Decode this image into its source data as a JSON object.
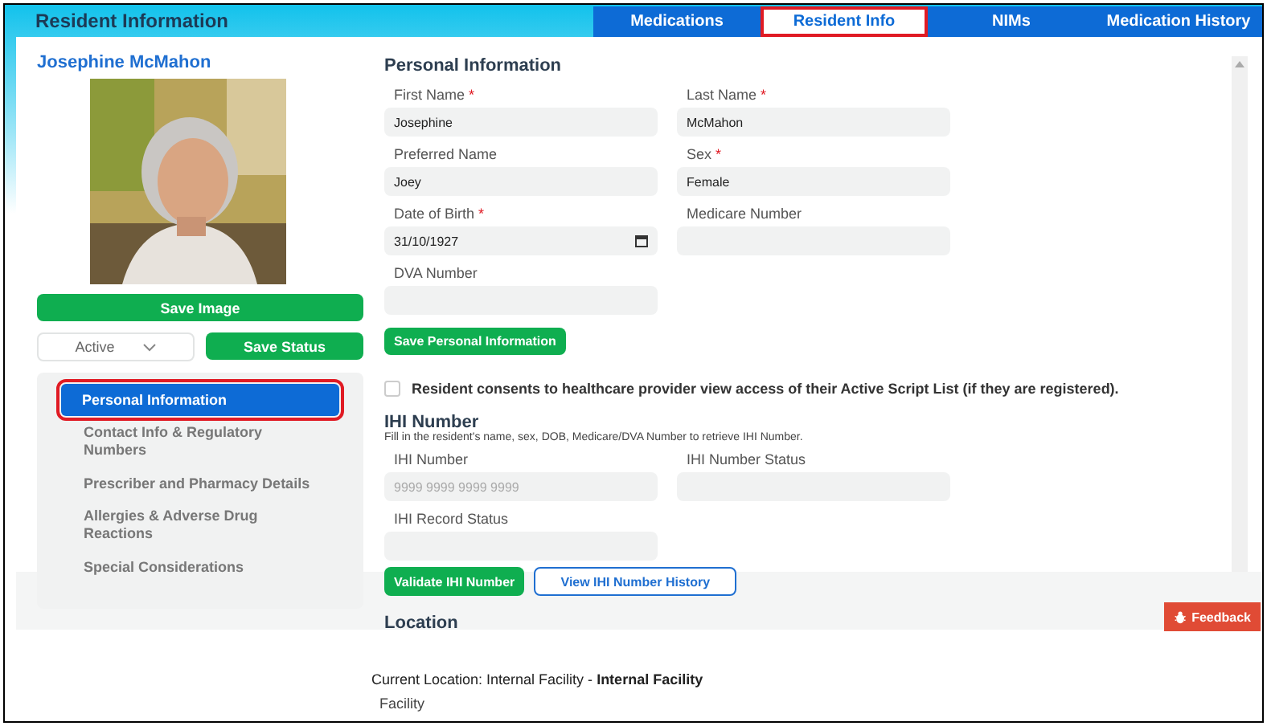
{
  "header": {
    "title": "Resident Information"
  },
  "tabs": [
    {
      "label": "Medications",
      "selected": false
    },
    {
      "label": "Resident Info",
      "selected": true
    },
    {
      "label": "NIMs",
      "selected": false
    },
    {
      "label": "Medication History",
      "selected": false
    }
  ],
  "resident": {
    "name": "Josephine McMahon",
    "save_image": "Save Image",
    "status": "Active",
    "save_status": "Save Status"
  },
  "nav": [
    {
      "label": "Personal Information",
      "selected": true
    },
    {
      "label": "Contact Info & Regulatory Numbers",
      "selected": false
    },
    {
      "label": "Prescriber and Pharmacy Details",
      "selected": false
    },
    {
      "label": "Allergies & Adverse Drug Reactions",
      "selected": false
    },
    {
      "label": "Special Considerations",
      "selected": false
    }
  ],
  "personal": {
    "title": "Personal Information",
    "fields": [
      {
        "label": "First Name",
        "required_mark": "*",
        "value": "Josephine",
        "kind": "text"
      },
      {
        "label": "Last Name",
        "required_mark": "*",
        "value": "McMahon",
        "kind": "text"
      },
      {
        "label": "Preferred Name",
        "value": "Joey",
        "kind": "text"
      },
      {
        "label": "Sex",
        "required_mark": "*",
        "value": "Female",
        "kind": "text"
      },
      {
        "label": "Date of Birth",
        "required_mark": "*",
        "value": "31/10/1927",
        "kind": "date"
      },
      {
        "label": "Medicare Number",
        "kind": "text"
      },
      {
        "label": "DVA Number",
        "kind": "text"
      }
    ],
    "save": "Save Personal Information",
    "consent": {
      "label": "Resident consents to healthcare provider view access of their Active Script List (if they are registered).",
      "checked": false
    }
  },
  "ihi": {
    "title": "IHI Number",
    "hint": "Fill in the resident's name, sex, DOB, Medicare/DVA Number to retrieve IHI Number.",
    "fields": [
      {
        "label": "IHI Number",
        "placeholder": "9999 9999 9999 9999"
      },
      {
        "label": "IHI Number Status"
      },
      {
        "label": "IHI Record Status"
      }
    ],
    "validate": "Validate IHI Number",
    "history": "View IHI Number History"
  },
  "location": {
    "title": "Location",
    "current": "Current Location: Internal Facility - **Internal Facility**",
    "facility_label": "Facility"
  },
  "feedback": "Feedback"
}
